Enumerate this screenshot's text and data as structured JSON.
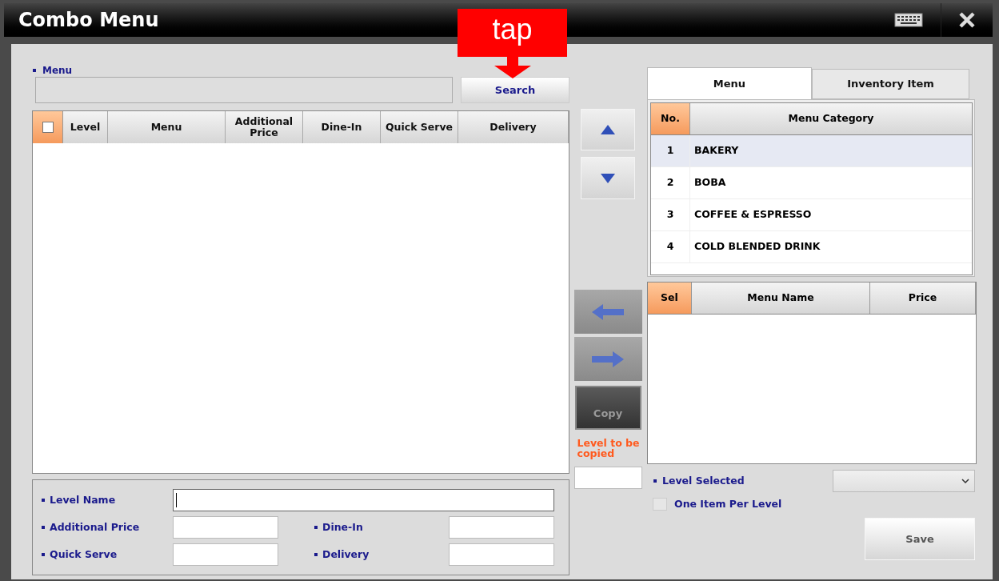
{
  "window": {
    "title": "Combo Menu"
  },
  "annotation": {
    "text": "tap"
  },
  "menu_search": {
    "label": "Menu",
    "button": "Search"
  },
  "level_table": {
    "header_checkbox": {
      "checked": false
    },
    "columns": [
      "Level",
      "Menu",
      "Additional Price",
      "Dine-In",
      "Quick Serve",
      "Delivery"
    ]
  },
  "copy_button": {
    "label": "Copy",
    "disabled": true
  },
  "copy_level": {
    "label": "Level to be copied"
  },
  "form": {
    "fields": [
      {
        "label": "Level Name",
        "focused": true
      },
      {
        "label": "Additional Price",
        "focused": false
      },
      {
        "label": "Dine-In",
        "focused": false
      },
      {
        "label": "Quick Serve",
        "focused": false
      },
      {
        "label": "Delivery",
        "focused": false
      }
    ]
  },
  "tabs": [
    {
      "label": "Menu",
      "selected": true
    },
    {
      "label": "Inventory Item",
      "selected": false
    }
  ],
  "category_table": {
    "columns": [
      "No.",
      "Menu Category"
    ],
    "rows": [
      {
        "no": "1",
        "name": "BAKERY",
        "selected": true
      },
      {
        "no": "2",
        "name": "BOBA",
        "selected": false
      },
      {
        "no": "3",
        "name": "COFFEE & ESPRESSO",
        "selected": false
      },
      {
        "no": "4",
        "name": "COLD BLENDED DRINK",
        "selected": false
      }
    ]
  },
  "menu_table": {
    "columns": [
      "Sel",
      "Menu Name",
      "Price"
    ]
  },
  "level_selected": {
    "label": "Level Selected"
  },
  "one_item_per_level": {
    "label": "One Item Per Level",
    "checked": false
  },
  "save_button": {
    "label": "Save"
  }
}
